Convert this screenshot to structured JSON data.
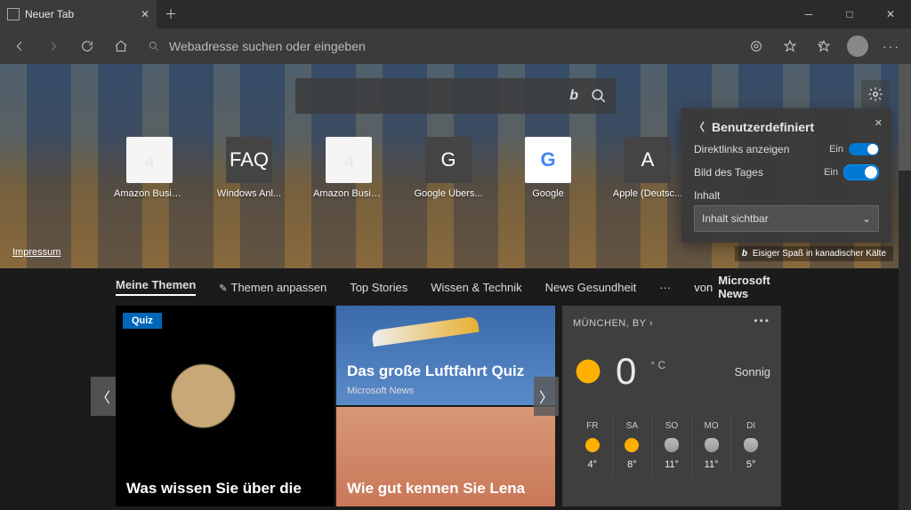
{
  "window": {
    "tab_title": "Neuer Tab"
  },
  "toolbar": {
    "address_placeholder": "Webadresse suchen oder eingeben"
  },
  "tiles": [
    {
      "label": "Amazon Busin...",
      "glyph": "a",
      "dark": false
    },
    {
      "label": "Windows Anl...",
      "glyph": "FAQ",
      "dark": true
    },
    {
      "label": "Amazon Busin...",
      "glyph": "a",
      "dark": false
    },
    {
      "label": "Google Übers...",
      "glyph": "G",
      "dark": true
    },
    {
      "label": "Google",
      "glyph": "G",
      "dark": false
    },
    {
      "label": "Apple (Deutsc...",
      "glyph": "A",
      "dark": true
    }
  ],
  "hero": {
    "impressum": "Impressum",
    "caption": "Eisiger Spaß in kanadischer Kälte"
  },
  "panel": {
    "title": "Benutzerdefiniert",
    "row1_label": "Direktlinks anzeigen",
    "row1_state": "Ein",
    "row2_label": "Bild des Tages",
    "row2_state": "Ein",
    "content_label": "Inhalt",
    "content_value": "Inhalt sichtbar"
  },
  "newsnav": {
    "items": [
      "Meine Themen",
      "Themen anpassen",
      "Top Stories",
      "Wissen & Technik",
      "News Gesundheit"
    ],
    "by": "von",
    "source": "Microsoft News"
  },
  "cards": {
    "quiz_badge": "Quiz",
    "c1_title": "Was wissen Sie über die",
    "c2_title": "Das große Luftfahrt Quiz",
    "c2_src": "Microsoft News",
    "c3_title": "Wie gut kennen Sie Lena"
  },
  "weather": {
    "location": "MÜNCHEN, BY",
    "temp": "0",
    "unit": "° C",
    "cond": "Sonnig",
    "days": [
      {
        "d": "FR",
        "hi": "4°",
        "icon": "sun"
      },
      {
        "d": "SA",
        "hi": "8°",
        "icon": "sun"
      },
      {
        "d": "SO",
        "hi": "11°",
        "icon": "cloud"
      },
      {
        "d": "MO",
        "hi": "11°",
        "icon": "cloud"
      },
      {
        "d": "DI",
        "hi": "5°",
        "icon": "cloud"
      }
    ]
  }
}
